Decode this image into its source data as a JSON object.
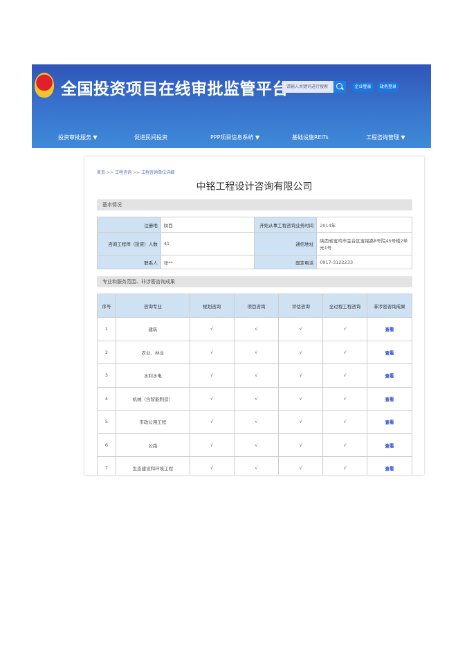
{
  "header": {
    "title": "全国投资项目在线审批监管平台",
    "search_placeholder": "请输入关键词进行搜索",
    "enterprise_login": "企业登录",
    "gov_login": "政务登录",
    "nav": [
      "投资审批服务 ▼",
      "促进民间投资",
      "PPP项目信息系统 ▼",
      "基础设施REITs",
      "工程咨询管理 ▼"
    ]
  },
  "breadcrumb": [
    "首页",
    "工程咨询",
    "工程咨询单位详细"
  ],
  "breadcrumb_sep": ">>",
  "company_name": "中铭工程设计咨询有限公司",
  "basic": {
    "heading": "基本情况",
    "reg_label": "注册地",
    "reg_value": "陕西",
    "start_label": "开始从事工程咨询业务时间",
    "start_value": "2014年",
    "staff_label": "咨询工程师（投资）人数",
    "staff_value": "41",
    "addr_label": "通信地址",
    "addr_value": "陕西省宝鸡市金台区宝福路8号院45号楼2单元1号",
    "contact_label": "联系人",
    "contact_value": "张**",
    "phone_label": "固定电话",
    "phone_value": "0917-3122233"
  },
  "scope": {
    "heading": "专业和服务范围、非涉密咨询成果",
    "columns": [
      "序号",
      "咨询专业",
      "规划咨询",
      "项目咨询",
      "评估咨询",
      "全过程工程咨询",
      "非涉密咨询成果"
    ],
    "rows": [
      {
        "no": "1",
        "major": "建筑",
        "c1": "√",
        "c2": "√",
        "c3": "√",
        "c4": "√",
        "link": "查看"
      },
      {
        "no": "2",
        "major": "农业、林业",
        "c1": "√",
        "c2": "√",
        "c3": "√",
        "c4": "√",
        "link": "查看"
      },
      {
        "no": "3",
        "major": "水利水电",
        "c1": "√",
        "c2": "√",
        "c3": "√",
        "c4": "√",
        "link": "查看"
      },
      {
        "no": "4",
        "major": "机械（含智能制造）",
        "c1": "√",
        "c2": "√",
        "c3": "√",
        "c4": "√",
        "link": "查看"
      },
      {
        "no": "5",
        "major": "市政公用工程",
        "c1": "√",
        "c2": "√",
        "c3": "√",
        "c4": "√",
        "link": "查看"
      },
      {
        "no": "6",
        "major": "公路",
        "c1": "√",
        "c2": "√",
        "c3": "√",
        "c4": "√",
        "link": "查看"
      },
      {
        "no": "7",
        "major": "生态建设和环境工程",
        "c1": "√",
        "c2": "√",
        "c3": "√",
        "c4": "√",
        "link": "查看"
      }
    ]
  }
}
